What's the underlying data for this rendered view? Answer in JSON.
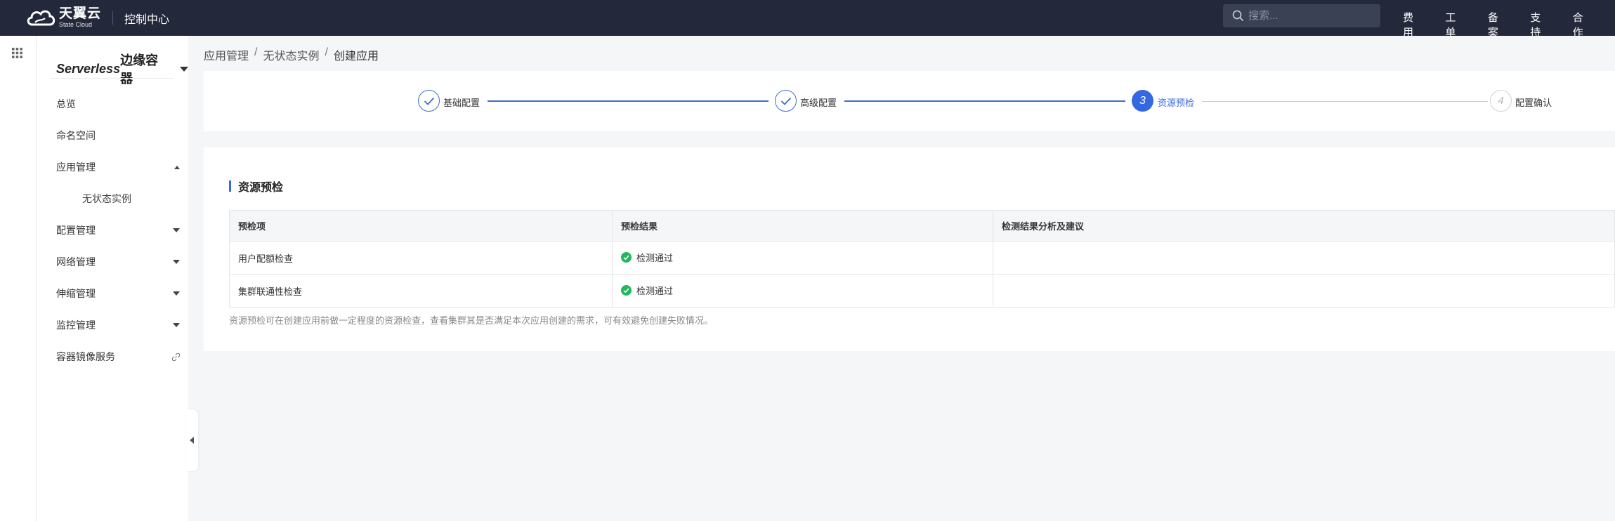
{
  "topbar": {
    "logo_main": "天翼云",
    "logo_sub": "State Cloud",
    "console_title": "控制中心",
    "search_placeholder": "搜索...",
    "nav": [
      "费用",
      "工单",
      "备案",
      "支持",
      "合作"
    ]
  },
  "sidebar": {
    "title_en": "Serverless",
    "title_cn": "边缘容器",
    "items": [
      {
        "label": "总览"
      },
      {
        "label": "命名空间"
      },
      {
        "label": "应用管理"
      },
      {
        "label": "无状态实例"
      },
      {
        "label": "配置管理"
      },
      {
        "label": "网络管理"
      },
      {
        "label": "伸缩管理"
      },
      {
        "label": "监控管理"
      },
      {
        "label": "容器镜像服务"
      }
    ]
  },
  "breadcrumb": {
    "items": [
      "应用管理",
      "无状态实例",
      "创建应用"
    ],
    "separator": "/"
  },
  "steps": [
    {
      "label": "基础配置",
      "state": "done",
      "number": "1"
    },
    {
      "label": "高级配置",
      "state": "done",
      "number": "2"
    },
    {
      "label": "资源预检",
      "state": "active",
      "number": "3"
    },
    {
      "label": "配置确认",
      "state": "todo",
      "number": "4"
    }
  ],
  "precheck": {
    "title": "资源预检",
    "columns": [
      "预检项",
      "预检结果",
      "检测结果分析及建议"
    ],
    "rows": [
      {
        "item": "用户配额检查",
        "result": "检测通过",
        "advice": ""
      },
      {
        "item": "集群联通性检查",
        "result": "检测通过",
        "advice": ""
      }
    ],
    "note": "资源预检可在创建应用前做一定程度的资源检查，查看集群其是否满足本次应用创建的需求，可有效避免创建失败情况。"
  },
  "colors": {
    "topbar_bg": "#23283a",
    "accent": "#3468e0",
    "success": "#1fb85c"
  }
}
